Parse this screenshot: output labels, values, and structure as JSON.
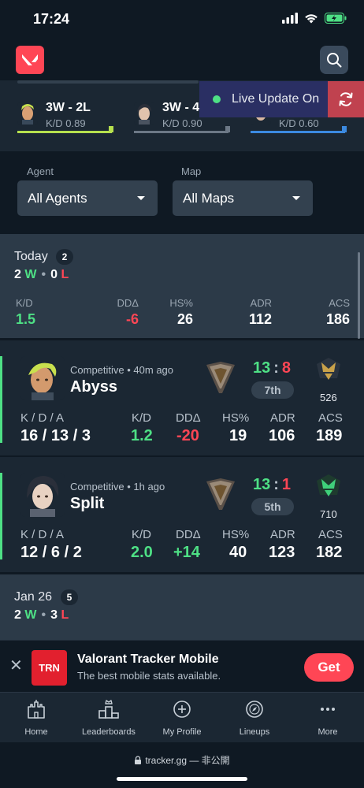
{
  "status_bar": {
    "time": "17:24"
  },
  "recent_agents": [
    {
      "wl": "3W - 2L",
      "kd": "K/D 0.89",
      "bar_color": "#b6e04e"
    },
    {
      "wl": "3W - 4",
      "kd": "K/D 0.90",
      "bar_color": "#6c7886"
    },
    {
      "wl": "",
      "kd": "K/D 0.60",
      "bar_color": "#3c8ae0"
    }
  ],
  "live_update": {
    "label": "Live Update On"
  },
  "filters": {
    "agent_label": "Agent",
    "agent_value": "All Agents",
    "map_label": "Map",
    "map_value": "All Maps"
  },
  "today": {
    "label": "Today",
    "count": "2",
    "wins": "2",
    "w": "W",
    "losses": "0",
    "l": "L",
    "stats": [
      {
        "label": "K/D",
        "value": "1.5",
        "color": "green"
      },
      {
        "label": "DDΔ",
        "value": "-6",
        "color": "red"
      },
      {
        "label": "HS%",
        "value": "26",
        "color": "white"
      },
      {
        "label": "ADR",
        "value": "112",
        "color": "white"
      },
      {
        "label": "ACS",
        "value": "186",
        "color": "white"
      }
    ]
  },
  "matches": [
    {
      "mode": "Competitive • 40m ago",
      "map": "Abyss",
      "score_us": "13",
      "score_sep": ":",
      "score_them": "8",
      "placement": "7th",
      "rr": "526",
      "kda_label": "K / D / A",
      "kda": "16 / 13 / 3",
      "kd_label": "K/D",
      "kd": "1.2",
      "dd_label": "DDΔ",
      "dd": "-20",
      "hs_label": "HS%",
      "hs": "19",
      "adr_label": "ADR",
      "adr": "106",
      "acs_label": "ACS",
      "acs": "189"
    },
    {
      "mode": "Competitive • 1h ago",
      "map": "Split",
      "score_us": "13",
      "score_sep": ":",
      "score_them": "1",
      "placement": "5th",
      "rr": "710",
      "kda_label": "K / D / A",
      "kda": "12 / 6 / 2",
      "kd_label": "K/D",
      "kd": "2.0",
      "dd_label": "DDΔ",
      "dd": "+14",
      "hs_label": "HS%",
      "hs": "40",
      "adr_label": "ADR",
      "adr": "123",
      "acs_label": "ACS",
      "acs": "182"
    }
  ],
  "jan26": {
    "label": "Jan 26",
    "count": "5",
    "wins": "2",
    "w": "W",
    "losses": "3",
    "l": "L"
  },
  "ad": {
    "logo": "TRN",
    "title": "Valorant Tracker Mobile",
    "subtitle": "The best mobile stats available.",
    "cta": "Get"
  },
  "tabs": [
    {
      "label": "Home",
      "icon": "castle-icon"
    },
    {
      "label": "Leaderboards",
      "icon": "podium-icon"
    },
    {
      "label": "My Profile",
      "icon": "plus-circle-icon"
    },
    {
      "label": "Lineups",
      "icon": "compass-icon"
    },
    {
      "label": "More",
      "icon": "more-dots-icon"
    }
  ],
  "url": "tracker.gg — 非公開",
  "colors": {
    "accent": "#ff4655",
    "win": "#4ee085",
    "loss": "#ff4655",
    "background": "#0f1923"
  }
}
